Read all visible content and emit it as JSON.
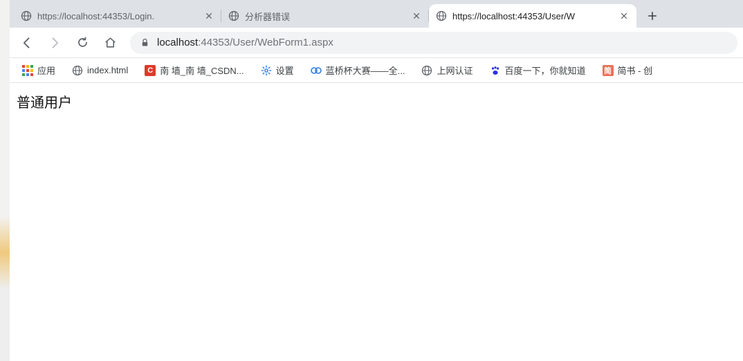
{
  "tabs": [
    {
      "title": "https://localhost:44353/Login.",
      "active": false
    },
    {
      "title": "分析器错误",
      "active": false
    },
    {
      "title": "https://localhost:44353/User/W",
      "active": true
    }
  ],
  "url": {
    "host": "localhost",
    "port": ":44353",
    "path": "/User/WebForm1.aspx"
  },
  "bookmarks": {
    "apps": "应用",
    "items": [
      {
        "label": "index.html",
        "icon": "globe"
      },
      {
        "label": "南 墙_南 墙_CSDN...",
        "icon": "csdn"
      },
      {
        "label": "设置",
        "icon": "gear"
      },
      {
        "label": "蓝桥杯大赛——全...",
        "icon": "lanqiao"
      },
      {
        "label": "上网认证",
        "icon": "globe"
      },
      {
        "label": "百度一下，你就知道",
        "icon": "baidu"
      },
      {
        "label": "简书 - 创",
        "icon": "jianshu"
      }
    ]
  },
  "page": {
    "heading": "普通用户"
  }
}
